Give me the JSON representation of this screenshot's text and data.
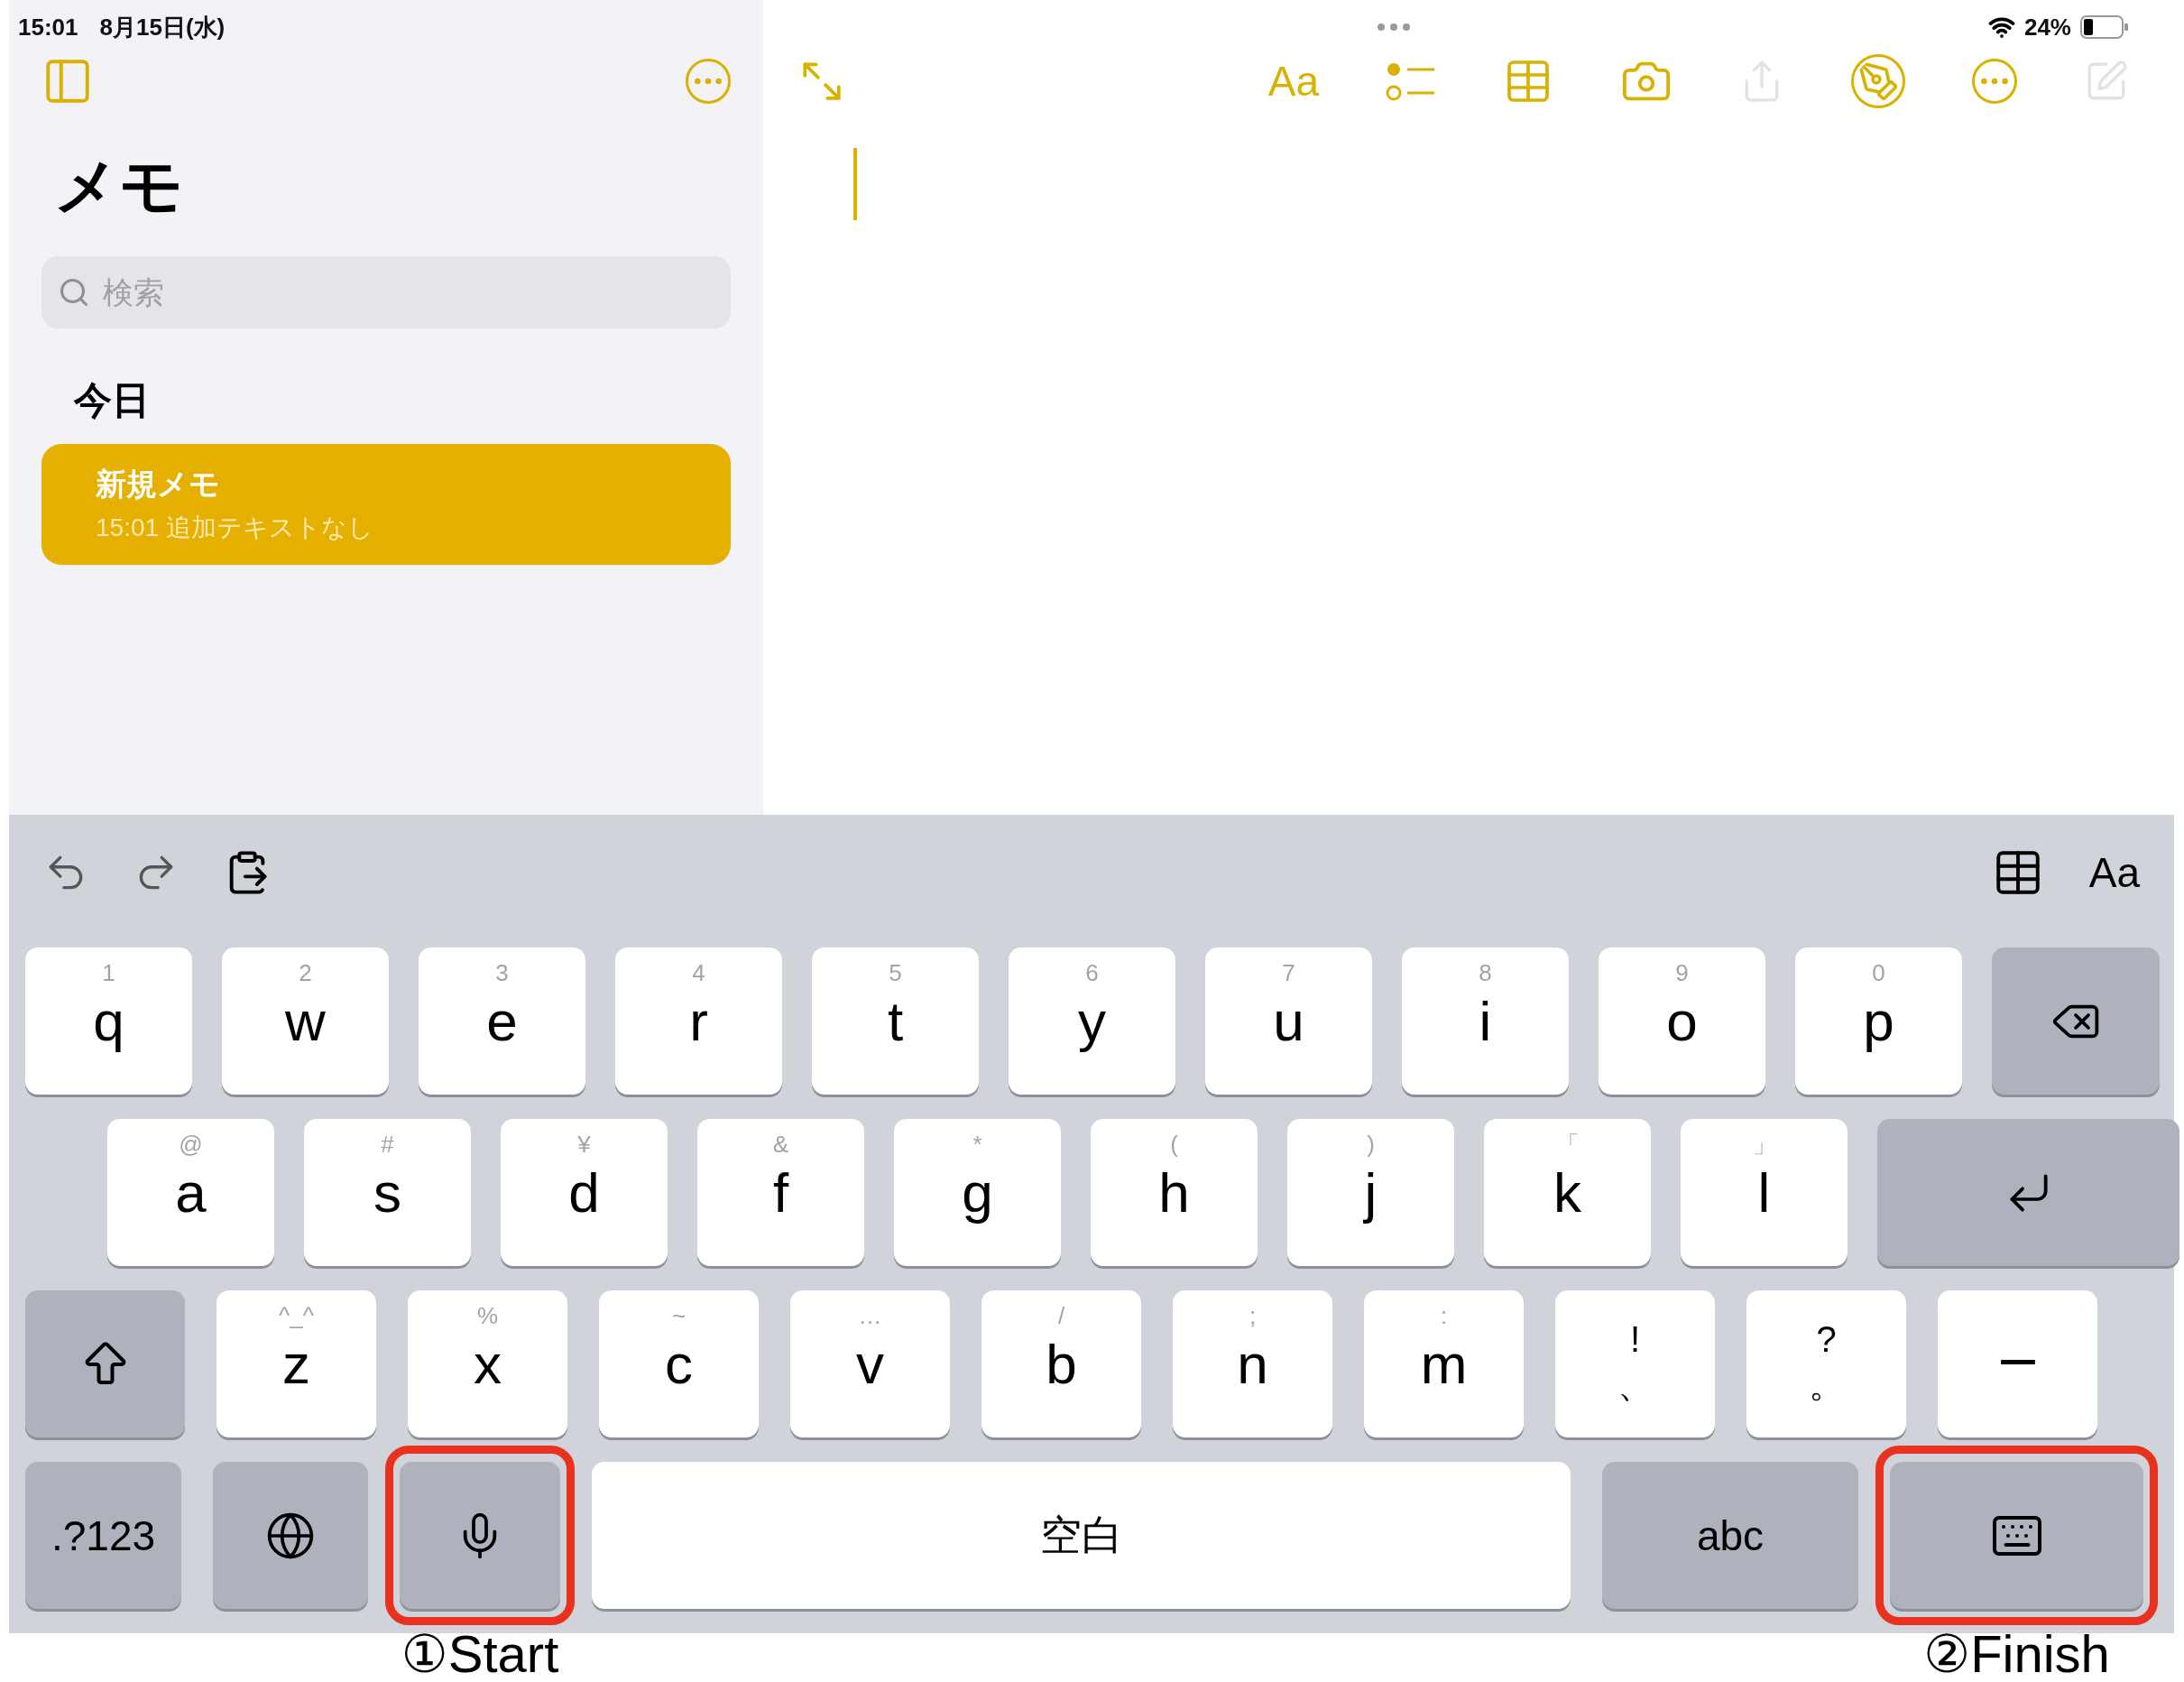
{
  "status_bar": {
    "time": "15:01",
    "date": "8月15日(水)",
    "battery": "24%"
  },
  "sidebar": {
    "title": "メモ",
    "search": {
      "placeholder": "検索"
    },
    "section": "今日",
    "notes": [
      {
        "title": "新規メモ",
        "subtitle": "15:01 追加テキストなし",
        "selected": true
      }
    ]
  },
  "editor_toolbar": {
    "format_label": "Aa"
  },
  "keyboard": {
    "toolbar": {
      "format_label": "Aa"
    },
    "rows": [
      {
        "keys": [
          {
            "kind": "letter",
            "label": "q",
            "hint": "1"
          },
          {
            "kind": "letter",
            "label": "w",
            "hint": "2"
          },
          {
            "kind": "letter",
            "label": "e",
            "hint": "3"
          },
          {
            "kind": "letter",
            "label": "r",
            "hint": "4"
          },
          {
            "kind": "letter",
            "label": "t",
            "hint": "5"
          },
          {
            "kind": "letter",
            "label": "y",
            "hint": "6"
          },
          {
            "kind": "letter",
            "label": "u",
            "hint": "7"
          },
          {
            "kind": "letter",
            "label": "i",
            "hint": "8"
          },
          {
            "kind": "letter",
            "label": "o",
            "hint": "9"
          },
          {
            "kind": "letter",
            "label": "p",
            "hint": "0"
          },
          {
            "kind": "delete"
          }
        ]
      },
      {
        "keys": [
          {
            "kind": "letter",
            "label": "a",
            "hint": "@"
          },
          {
            "kind": "letter",
            "label": "s",
            "hint": "#"
          },
          {
            "kind": "letter",
            "label": "d",
            "hint": "¥"
          },
          {
            "kind": "letter",
            "label": "f",
            "hint": "&"
          },
          {
            "kind": "letter",
            "label": "g",
            "hint": "*"
          },
          {
            "kind": "letter",
            "label": "h",
            "hint": "("
          },
          {
            "kind": "letter",
            "label": "j",
            "hint": ")"
          },
          {
            "kind": "letter",
            "label": "k",
            "hint": "「"
          },
          {
            "kind": "letter",
            "label": "l",
            "hint": "」"
          },
          {
            "kind": "return"
          }
        ]
      },
      {
        "keys": [
          {
            "kind": "shift"
          },
          {
            "kind": "letter",
            "label": "z",
            "hint": "^_^"
          },
          {
            "kind": "letter",
            "label": "x",
            "hint": "%"
          },
          {
            "kind": "letter",
            "label": "c",
            "hint": "~"
          },
          {
            "kind": "letter",
            "label": "v",
            "hint": "…"
          },
          {
            "kind": "letter",
            "label": "b",
            "hint": "/"
          },
          {
            "kind": "letter",
            "label": "n",
            "hint": ";"
          },
          {
            "kind": "letter",
            "label": "m",
            "hint": ":"
          },
          {
            "kind": "punct",
            "label": "、",
            "hint": "!"
          },
          {
            "kind": "punct",
            "label": "。",
            "hint": "?"
          },
          {
            "kind": "dash",
            "label": "ー"
          }
        ]
      },
      {
        "keys": [
          {
            "kind": "mode",
            "label": ".?123",
            "highlighted": false
          },
          {
            "kind": "globe",
            "highlighted": false
          },
          {
            "kind": "mic",
            "highlighted": true,
            "caption": "①Start"
          },
          {
            "kind": "space",
            "label": "空白",
            "highlighted": false
          },
          {
            "kind": "abc",
            "label": "abc",
            "highlighted": false
          },
          {
            "kind": "dismiss",
            "highlighted": true,
            "caption": "②Finish"
          }
        ]
      }
    ]
  }
}
